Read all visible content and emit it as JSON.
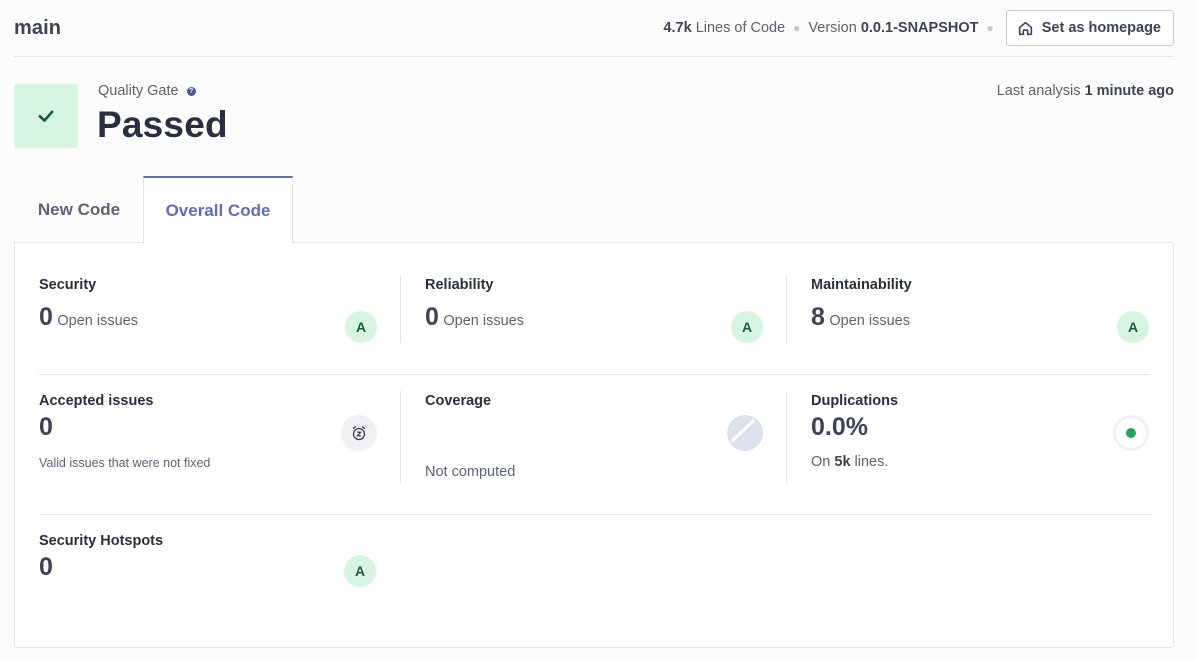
{
  "header": {
    "branch": "main",
    "loc_value": "4.7k",
    "loc_label": "Lines of Code",
    "version_label": "Version",
    "version_value": "0.0.1-SNAPSHOT",
    "homepage_button": "Set as homepage"
  },
  "quality_gate": {
    "label": "Quality Gate",
    "help": "?",
    "status": "Passed",
    "last_analysis_label": "Last analysis",
    "last_analysis_value": "1 minute ago",
    "status_color": "#d5f5e1"
  },
  "tabs": [
    {
      "label": "New Code",
      "active": false
    },
    {
      "label": "Overall Code",
      "active": true
    }
  ],
  "metrics": {
    "security": {
      "title": "Security",
      "value": "0",
      "unit": "Open issues",
      "grade": "A"
    },
    "reliability": {
      "title": "Reliability",
      "value": "0",
      "unit": "Open issues",
      "grade": "A"
    },
    "maintainability": {
      "title": "Maintainability",
      "value": "8",
      "unit": "Open issues",
      "grade": "A"
    },
    "accepted": {
      "title": "Accepted issues",
      "value": "0",
      "description": "Valid issues that were not fixed",
      "icon": "snooze-clock-icon"
    },
    "coverage": {
      "title": "Coverage",
      "description": "Not computed",
      "icon": "coverage-empty-icon"
    },
    "duplications": {
      "title": "Duplications",
      "value": "0.0%",
      "prefix": "On",
      "lines": "5k",
      "suffix": "lines."
    },
    "hotspots": {
      "title": "Security Hotspots",
      "value": "0",
      "grade": "A"
    }
  },
  "colors": {
    "accent": "#5f6dbb",
    "grade_bg": "#d5f5e1",
    "grade_fg": "#1e5c39",
    "dup_dot": "#21a45b"
  }
}
